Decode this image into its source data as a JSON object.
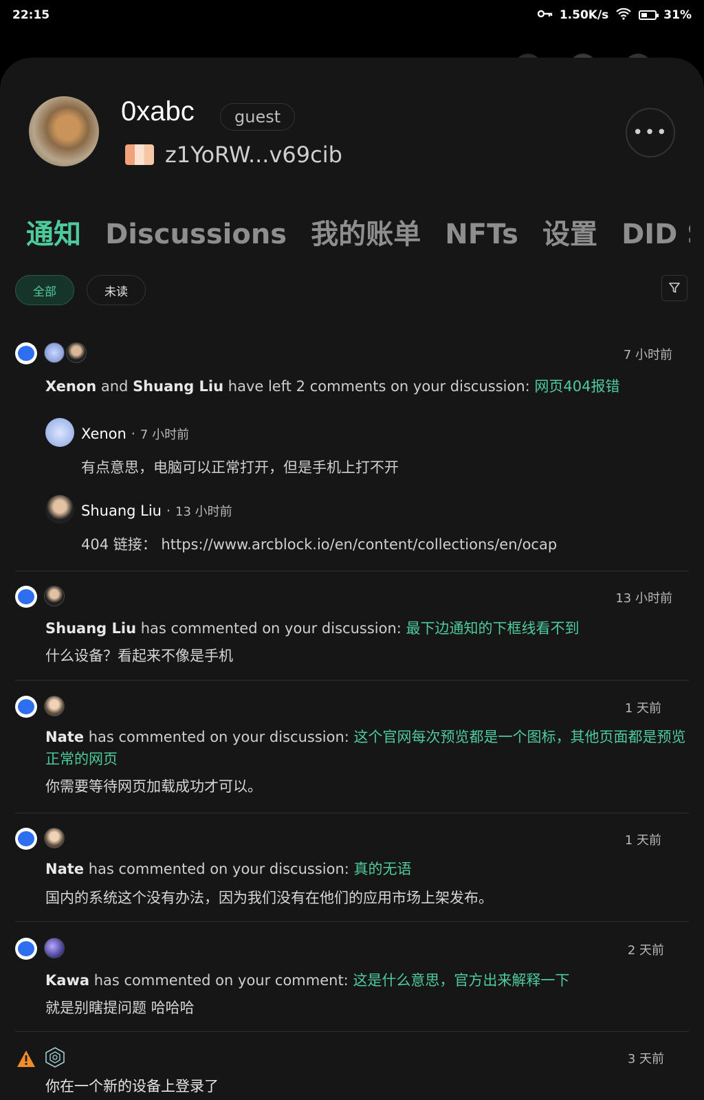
{
  "status_bar": {
    "time": "22:15",
    "network_speed": "1.50K/s",
    "battery": "31%"
  },
  "profile": {
    "username": "0xabc",
    "role": "guest",
    "did": "z1YoRW...v69cib",
    "more_label": "•••"
  },
  "tabs": [
    {
      "label": "通知",
      "active": true
    },
    {
      "label": "Discussions"
    },
    {
      "label": "我的账单"
    },
    {
      "label": "NFTs"
    },
    {
      "label": "设置"
    },
    {
      "label": "DID Spa"
    }
  ],
  "filters": {
    "all": "全部",
    "unread": "未读"
  },
  "notifications": [
    {
      "time": "7 小时前",
      "actor1": "Xenon",
      "and": " and ",
      "actor2": "Shuang Liu",
      "action": " have left 2 comments on your discussion: ",
      "target": "网页404报错",
      "replies": [
        {
          "name": "Xenon",
          "time": "7 小时前",
          "text": "有点意思，电脑可以正常打开，但是手机上打不开"
        },
        {
          "name": "Shuang Liu",
          "time": "13 小时前",
          "text": "404 链接： https://www.arcblock.io/en/content/collections/en/ocap"
        }
      ]
    },
    {
      "time": "13 小时前",
      "actor": "Shuang Liu",
      "action": " has commented on your discussion: ",
      "target": "最下边通知的下框线看不到",
      "body": "什么设备？看起来不像是手机"
    },
    {
      "time": "1 天前",
      "actor": "Nate",
      "action": " has commented on your discussion: ",
      "target": "这个官网每次预览都是一个图标，其他页面都是预览",
      "target2": "正常的网页",
      "body": "你需要等待网页加载成功才可以。"
    },
    {
      "time": "1 天前",
      "actor": "Nate",
      "action": " has commented on your discussion: ",
      "target": "真的无语",
      "body": "国内的系统这个没有办法，因为我们没有在他们的应用市场上架发布。"
    },
    {
      "time": "2 天前",
      "actor": "Kawa",
      "action": " has commented on your comment: ",
      "target": "这是什么意思，官方出来解释一下",
      "body": "就是别瞎提问题 哈哈哈"
    },
    {
      "time": "3 天前",
      "body": "你在一个新的设备上登录了"
    }
  ],
  "colors": {
    "accent": "#4ecb9d",
    "bubble": "#2e6ff2",
    "warning": "#f28c28"
  }
}
